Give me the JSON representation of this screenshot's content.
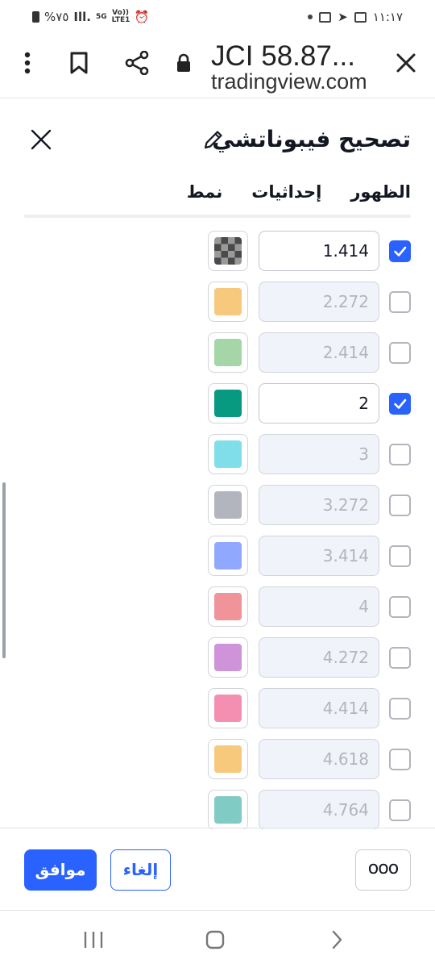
{
  "status_bar": {
    "battery_text": "%٧٥",
    "network_label": "5G",
    "volte_label": "Vo)) LTE1",
    "time": "١١:١٧"
  },
  "browser": {
    "page_title": "JCI 58.87...",
    "domain": "tradingview.com"
  },
  "dialog": {
    "title": "تصحيح فيبوناتشي",
    "tabs": [
      {
        "label": "نمط",
        "active": true
      },
      {
        "label": "إحداثيات",
        "active": false
      },
      {
        "label": "الظهور",
        "active": false
      }
    ],
    "levels": [
      {
        "value": "1.414",
        "checked": true,
        "color": "checker"
      },
      {
        "value": "2.272",
        "checked": false,
        "color": "#f7c97d"
      },
      {
        "value": "2.414",
        "checked": false,
        "color": "#a5d6a7"
      },
      {
        "value": "2",
        "checked": true,
        "color": "#089981"
      },
      {
        "value": "3",
        "checked": false,
        "color": "#80deea"
      },
      {
        "value": "3.272",
        "checked": false,
        "color": "#b2b5be"
      },
      {
        "value": "3.414",
        "checked": false,
        "color": "#90a9ff"
      },
      {
        "value": "4",
        "checked": false,
        "color": "#f0949a"
      },
      {
        "value": "4.272",
        "checked": false,
        "color": "#ce93d8"
      },
      {
        "value": "4.414",
        "checked": false,
        "color": "#f48fb1"
      },
      {
        "value": "4.618",
        "checked": false,
        "color": "#f7c97d"
      },
      {
        "value": "4.764",
        "checked": false,
        "color": "#80cbc4"
      }
    ],
    "buttons": {
      "ok": "موافق",
      "cancel": "إلغاء",
      "more": "ooo"
    }
  }
}
